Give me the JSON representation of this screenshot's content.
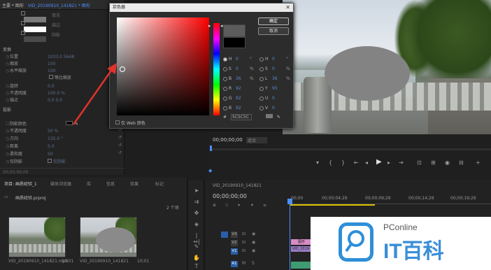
{
  "effect_controls": {
    "tab_title": "主要 * 图形",
    "clip_name": "VID_20190910_141821 * 图形",
    "swatch_rows": [
      {
        "label": "填充",
        "color": "#7a7a7a"
      },
      {
        "label": "描边",
        "color": "#ffffff"
      },
      {
        "label": "阴影",
        "color": "#4a4a4a"
      }
    ],
    "transform_section": "变换",
    "transform_props": [
      {
        "label": "位置",
        "value": "1033.0  5648"
      },
      {
        "label": "缩放",
        "value": "100"
      },
      {
        "label": "水平缩放",
        "value": "100"
      },
      {
        "label": "等比缩放",
        "value": ""
      },
      {
        "label": "旋转",
        "value": "0.0"
      },
      {
        "label": "不透明度",
        "value": "100.0 %"
      },
      {
        "label": "锚点",
        "value": "0.0  0.0"
      }
    ],
    "shadow_section": "投影",
    "shadow_props": [
      {
        "label": "阴影颜色",
        "value": ""
      },
      {
        "label": "不透明度",
        "value": "50 %"
      },
      {
        "label": "方向",
        "value": "135.0 °"
      },
      {
        "label": "距离",
        "value": "5.0"
      },
      {
        "label": "柔和度",
        "value": "50"
      },
      {
        "label": "仅阴影",
        "value": "仅阴影"
      }
    ],
    "bottom_time": "00;00;00;00"
  },
  "project": {
    "tabs": [
      "项目: 画质经验_1",
      "媒体浏览器",
      "库",
      "信息",
      "效果",
      "标记"
    ],
    "file_name": "画质经验.prproj",
    "item_count": "2 个项",
    "items": [
      {
        "name": "VID_20190910_141821.mp4",
        "duration": "10;01"
      },
      {
        "name": "VID_20190910_141821",
        "duration": "10;01"
      }
    ]
  },
  "color_picker": {
    "title": "拾色器",
    "ok_label": "确定",
    "cancel_label": "取消",
    "new_color": "#5c5c5c",
    "old_color": "#000000",
    "fields_left": [
      {
        "key": "H",
        "value": "0",
        "unit": "°",
        "selected": true
      },
      {
        "key": "S",
        "value": "0",
        "unit": "%",
        "selected": false
      },
      {
        "key": "B",
        "value": "36",
        "unit": "%",
        "selected": false
      },
      {
        "key": "R",
        "value": "92",
        "unit": "",
        "selected": false
      },
      {
        "key": "G",
        "value": "92",
        "unit": "",
        "selected": false
      },
      {
        "key": "B",
        "value": "92",
        "unit": "",
        "selected": false
      }
    ],
    "fields_right": [
      {
        "key": "H",
        "value": "0",
        "unit": "°"
      },
      {
        "key": "S",
        "value": "0",
        "unit": "%"
      },
      {
        "key": "L",
        "value": "36",
        "unit": "%"
      },
      {
        "key": "Y",
        "value": "95",
        "unit": ""
      },
      {
        "key": "U",
        "value": "0",
        "unit": ""
      },
      {
        "key": "V",
        "value": "0",
        "unit": ""
      }
    ],
    "hex_prefix": "#",
    "hex_value": "5C5C5C",
    "web_only_label": "仅 Web 颜色"
  },
  "program": {
    "timecode": "00;00;00;00",
    "fit_label": "适合"
  },
  "timeline": {
    "sequence_tab": "VID_20190910_141821",
    "timecode": "00;00;00;00",
    "ruler_ticks": [
      "00;00",
      "00;00;04;29",
      "00;00;09;29",
      "00;00;14;29",
      "00;00;19;29"
    ],
    "video_tracks": [
      "V3",
      "V2",
      "V1"
    ],
    "audio_tracks": [
      "A1",
      "A2"
    ],
    "clip_top_label": "图形",
    "clip_mid_label": "VID_2019"
  },
  "watermark": {
    "brand_small": "PConline",
    "brand_big": "IT百科"
  },
  "colors": {
    "accent": "#4c8dff",
    "arrow": "#e0332a",
    "playhead_range": "#d8c000"
  }
}
